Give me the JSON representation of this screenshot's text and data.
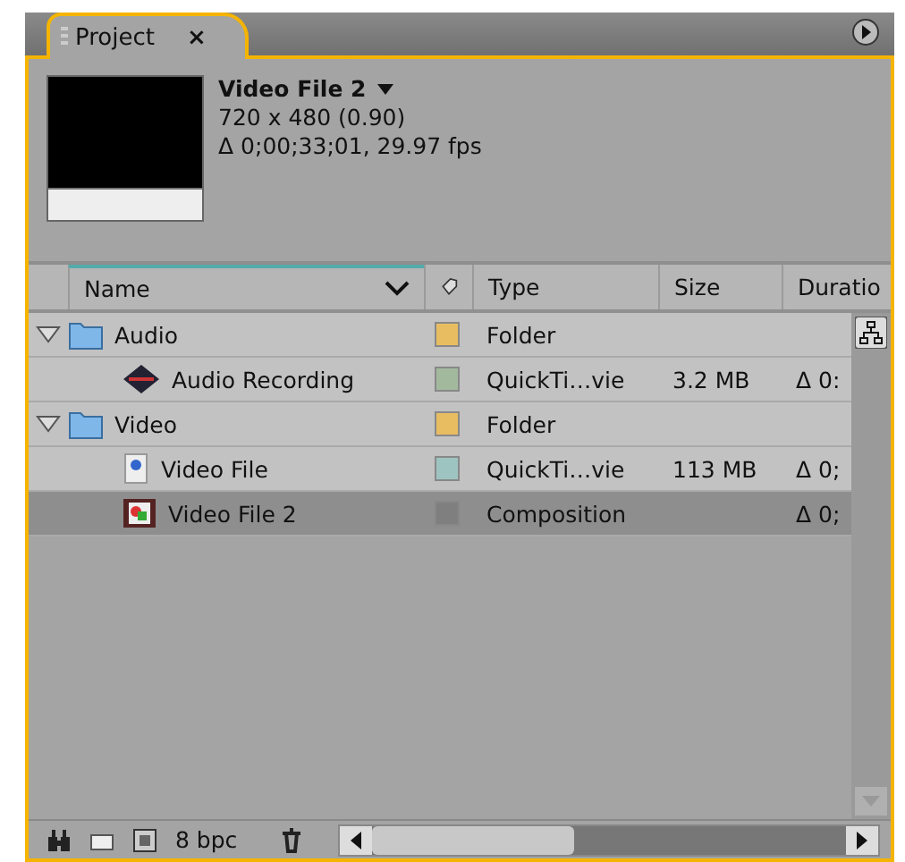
{
  "panel": {
    "tab": {
      "label": "Project",
      "close": "×",
      "selected": true
    }
  },
  "preview": {
    "title": "Video File 2",
    "dimensions": "720 x 480 (0.90)",
    "duration": "Δ 0;00;33;01, 29.97 fps"
  },
  "table": {
    "columns": [
      {
        "kind": "name",
        "label": "Name"
      },
      {
        "kind": "label"
      },
      {
        "kind": "type",
        "label": "Type"
      },
      {
        "kind": "size",
        "label": "Size"
      },
      {
        "kind": "duration",
        "label": "Duratio"
      }
    ],
    "rows": [
      {
        "kind": "folder",
        "name": "Audio",
        "type": "Folder",
        "color": "#e8bd62",
        "expanded": true,
        "selected": false,
        "children": [
          {
            "kind": "audio",
            "name": "Audio Recording",
            "type": "QuickTi…vie",
            "size": "3.2 MB",
            "duration": "Δ 0:",
            "color": "#a3b99e",
            "selected": false
          }
        ]
      },
      {
        "kind": "folder",
        "name": "Video",
        "type": "Folder",
        "color": "#e8bd62",
        "expanded": true,
        "selected": false,
        "children": [
          {
            "kind": "video",
            "name": "Video File",
            "type": "QuickTi…vie",
            "size": "113 MB",
            "duration": "Δ 0;",
            "color": "#9ec4c1",
            "selected": false
          },
          {
            "kind": "comp",
            "name": "Video File 2",
            "type": "Composition",
            "duration": "Δ 0;",
            "color": "#7f7f7f",
            "selected": true
          }
        ]
      }
    ]
  },
  "footer": {
    "depth": "8 bpc"
  }
}
